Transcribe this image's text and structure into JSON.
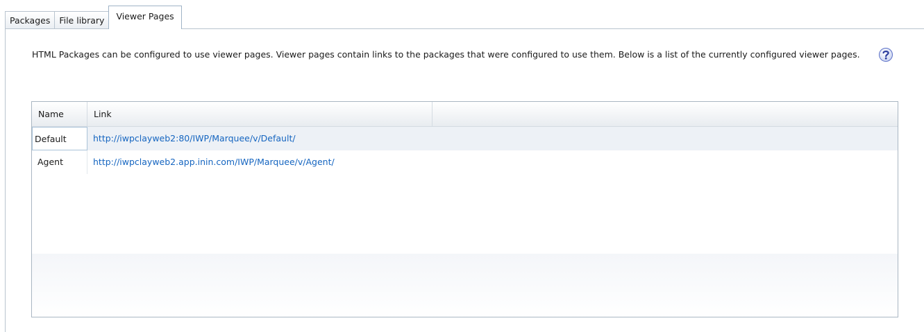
{
  "tabs": [
    {
      "label": "Packages"
    },
    {
      "label": "File library"
    },
    {
      "label": "Viewer Pages"
    }
  ],
  "description": "HTML Packages can be configured to use viewer pages.  Viewer pages contain links to the packages that were configured to use them.  Below is a list of the currently configured viewer pages.",
  "help_icon": "help-question-icon",
  "table": {
    "columns": [
      "Name",
      "Link"
    ],
    "rows": [
      {
        "name": "Default",
        "link": "http://iwpclayweb2:80/IWP/Marquee/v/Default/"
      },
      {
        "name": "Agent",
        "link": "http://iwpclayweb2.app.inin.com/IWP/Marquee/v/Agent/"
      }
    ]
  },
  "colors": {
    "link": "#1565c0",
    "border": "#b9c4cf",
    "selected_row": "#edf1f6"
  }
}
